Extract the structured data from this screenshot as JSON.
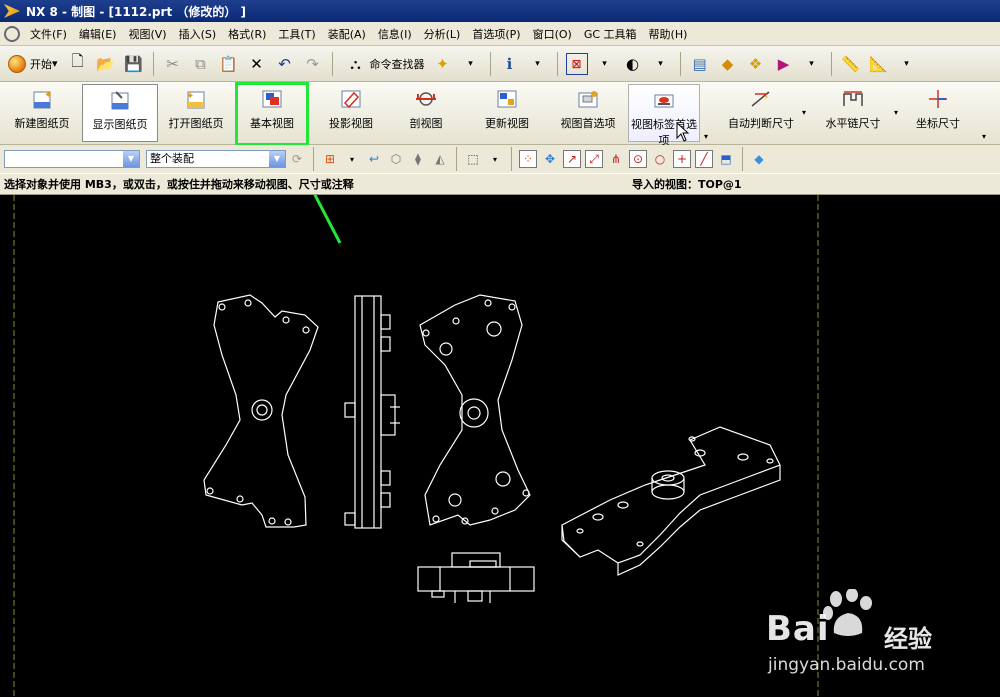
{
  "window": {
    "title": "NX 8 - 制图 - [1112.prt （修改的） ]"
  },
  "menu": [
    "文件(F)",
    "编辑(E)",
    "视图(V)",
    "插入(S)",
    "格式(R)",
    "工具(T)",
    "装配(A)",
    "信息(I)",
    "分析(L)",
    "首选项(P)",
    "窗口(O)",
    "GC 工具箱",
    "帮助(H)"
  ],
  "toolbar": {
    "start_label": "开始",
    "command_finder": "命令查找器"
  },
  "drawing_toolbar": {
    "new_sheet": "新建图纸页",
    "show_sheet": "显示图纸页",
    "open_sheet": "打开图纸页",
    "base_view": "基本视图",
    "projected_view": "投影视图",
    "section_view": "剖视图",
    "update_view": "更新视图",
    "view_prefs": "视图首选项",
    "view_label_prefs_line1": "视图标签首选",
    "view_label_prefs_line2": "项",
    "auto_dim": "自动判断尺寸",
    "horiz_chain_dim": "水平链尺寸",
    "coord_dim": "坐标尺寸"
  },
  "selection_bar": {
    "filter_value": "",
    "scope_value": "整个装配"
  },
  "status": {
    "prompt": "选择对象并使用 MB3，或双击，或按住并拖动来移动视图、尺寸或注释",
    "imported_view": "导入的视图：TOP@1"
  },
  "watermark": {
    "brand": "Bai",
    "brand_suffix": "经验",
    "paw_text": "du",
    "url": "jingyan.baidu.com"
  },
  "colors": {
    "highlight": "#22e63a",
    "titlebar": "#0b2a74",
    "canvas": "#000000"
  }
}
